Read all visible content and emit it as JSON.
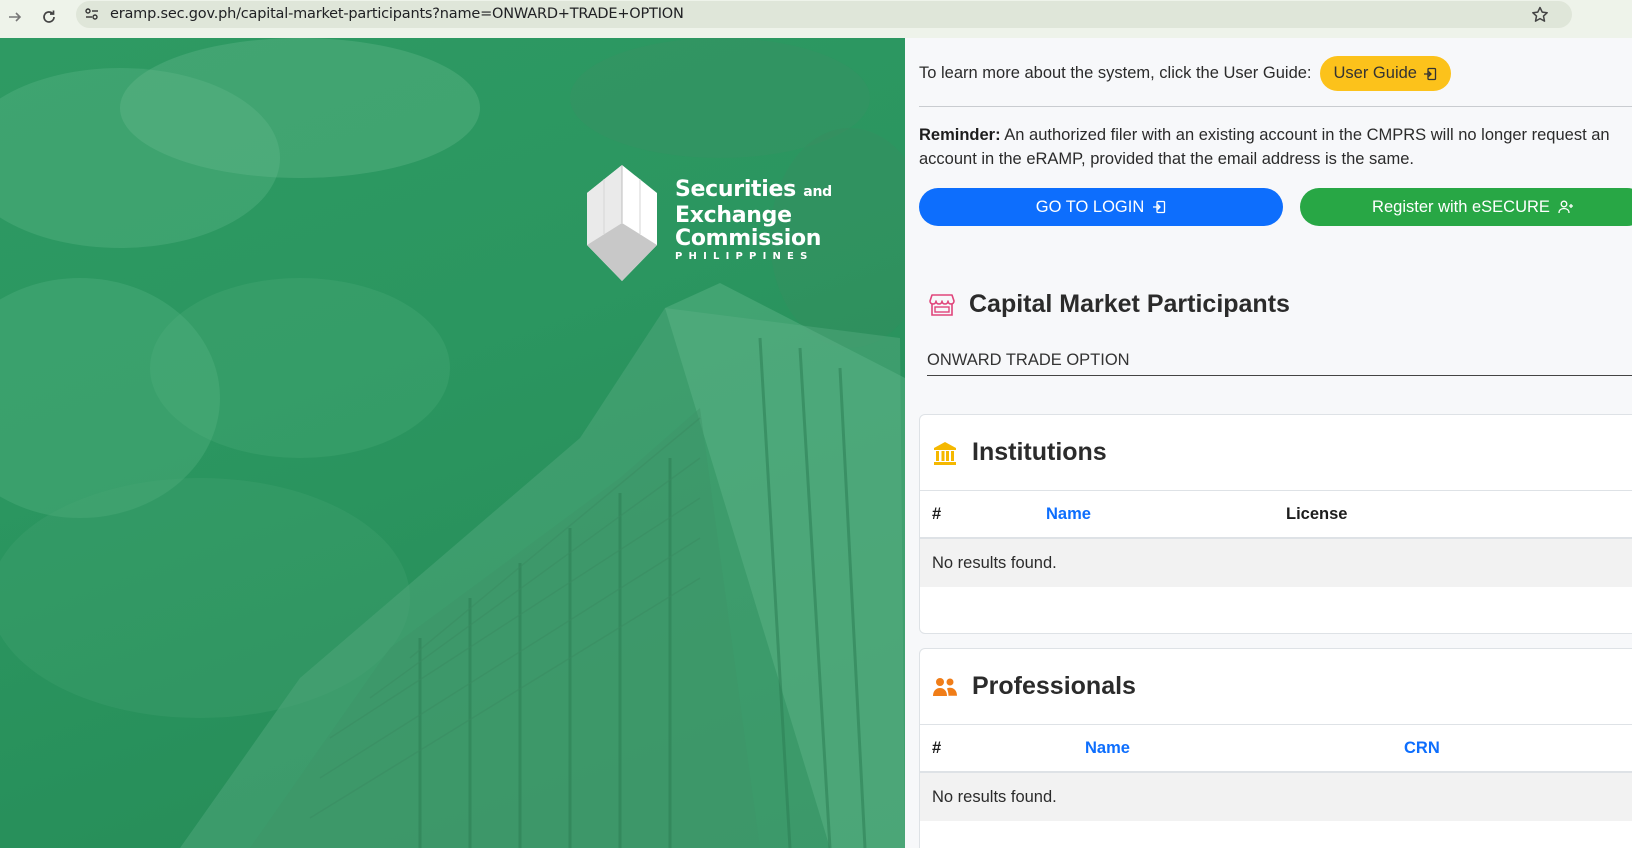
{
  "browser": {
    "url": "eramp.sec.gov.ph/capital-market-participants?name=ONWARD+TRADE+OPTION",
    "icons": [
      "forward-icon",
      "reload-icon",
      "site-info-icon",
      "bookmark-star-icon"
    ]
  },
  "logo": {
    "line1": "Securities",
    "line1_suffix": "and",
    "line2": "Exchange",
    "line3": "Commission",
    "line4": "PHILIPPINES"
  },
  "guide": {
    "text": "To learn more about the system, click the User Guide:",
    "button_label": "User Guide"
  },
  "reminder": {
    "label": "Reminder:",
    "text": " An authorized filer with an existing account in the CMPRS will no longer request an account in the eRAMP, provided that the email address is the same."
  },
  "buttons": {
    "login": "GO TO LOGIN",
    "register": "Register with eSECURE"
  },
  "cmp": {
    "title": "Capital Market Participants",
    "search_value": "ONWARD TRADE OPTION"
  },
  "institutions": {
    "title": "Institutions",
    "columns": [
      "#",
      "Name",
      "License"
    ],
    "empty": "No results found."
  },
  "professionals": {
    "title": "Professionals",
    "columns": [
      "#",
      "Name",
      "CRN"
    ],
    "empty": "No results found."
  },
  "colors": {
    "hero_green": "#2b9660",
    "primary_blue": "#0d6efd",
    "success_green": "#28a745",
    "guide_yellow": "#fcc21b",
    "store_icon_pink": "#e0457b",
    "bank_icon_yellow": "#f5b800",
    "people_icon_orange": "#f07d18"
  }
}
